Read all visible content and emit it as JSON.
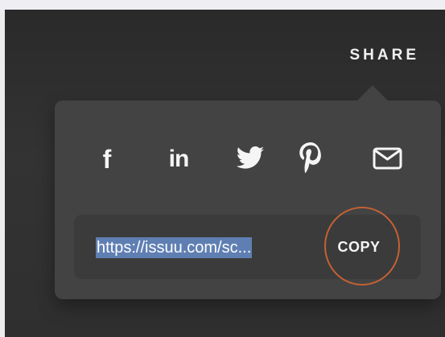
{
  "header": {
    "share_label": "SHARE"
  },
  "share_popover": {
    "icons": [
      "facebook-icon",
      "linkedin-icon",
      "twitter-icon",
      "pinterest-icon",
      "email-icon"
    ],
    "facebook_label": "f",
    "linkedin_label": "in",
    "link_value": "https://issuu.com/sc...",
    "copy_label": "COPY"
  },
  "colors": {
    "background": "#2f2f2f",
    "popover": "#434343",
    "selection": "#5f7fb3",
    "highlight_ring": "#c46134"
  }
}
